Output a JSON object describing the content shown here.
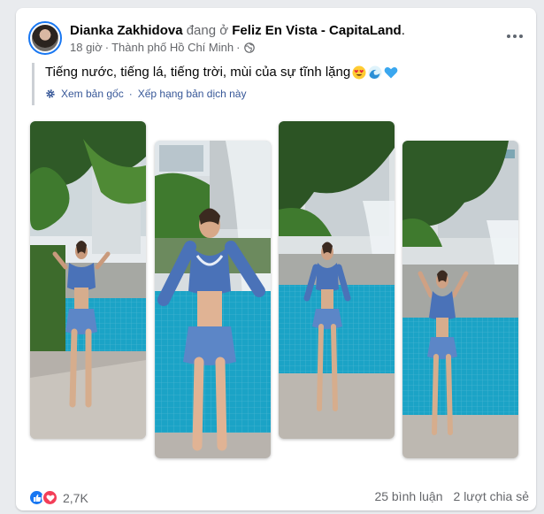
{
  "post": {
    "author": "Dianka Zakhidova",
    "connector": "đang ở",
    "place": "Feliz En Vista - CapitaLand",
    "place_suffix": ".",
    "time": "18 giờ",
    "meta_sep": "·",
    "location": "Thành phố Hồ Chí Minh",
    "location_sep": "·",
    "caption": "Tiếng nước, tiếng lá, tiếng trời, mùi của sự tĩnh lặng",
    "caption_emojis": [
      "heart-eyes-emoji",
      "wave-emoji",
      "blue-heart-emoji"
    ],
    "see_original": "Xem bản gốc",
    "translate_sep": "·",
    "rate_translation": "Xếp hạng bản dịch này",
    "photos": [
      "photo-1",
      "photo-2",
      "photo-3",
      "photo-4"
    ]
  },
  "footer": {
    "reaction_count": "2,7K",
    "comments": "25 bình luận",
    "shares": "2 lượt chia sẻ"
  },
  "colors": {
    "link": "#385898",
    "accent": "#1877f2",
    "secondary_text": "#65676b",
    "pool": "#1ba3c6",
    "swimsuit": "#4a72b8"
  }
}
